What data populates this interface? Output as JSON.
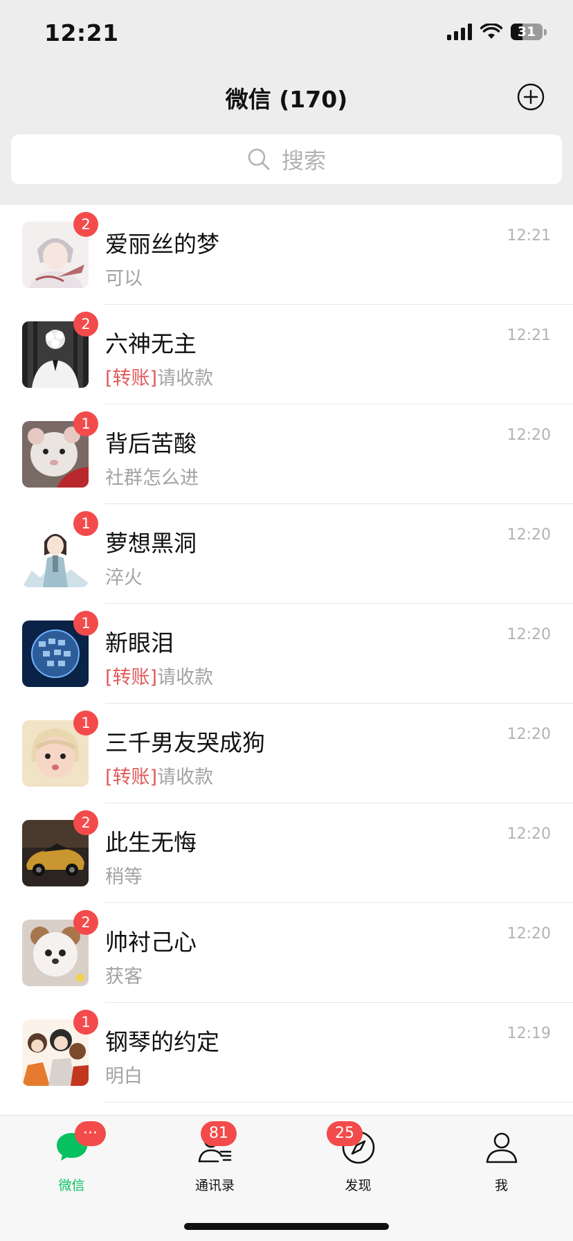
{
  "status": {
    "time": "12:21",
    "battery": "31"
  },
  "header": {
    "title": "微信 (170)"
  },
  "search": {
    "placeholder": "搜索"
  },
  "colors": {
    "accent": "#07c160",
    "badge": "#f34b4b",
    "transfer_tag": "#e05a5a"
  },
  "chats": [
    {
      "name": "爱丽丝的梦",
      "tag": "",
      "message": "可以",
      "time": "12:21",
      "badge": "2",
      "avatar": "anime-sketch"
    },
    {
      "name": "六神无主",
      "tag": "[转账]",
      "message": "请收款",
      "time": "12:21",
      "badge": "2",
      "avatar": "man-with-flowers"
    },
    {
      "name": "背后苦酸",
      "tag": "",
      "message": "社群怎么进",
      "time": "12:20",
      "badge": "1",
      "avatar": "hamster"
    },
    {
      "name": "萝想黑洞",
      "tag": "",
      "message": "淬火",
      "time": "12:20",
      "badge": "1",
      "avatar": "anime-girl"
    },
    {
      "name": "新眼泪",
      "tag": "[转账]",
      "message": "请收款",
      "time": "12:20",
      "badge": "1",
      "avatar": "globe"
    },
    {
      "name": "三千男友哭成狗",
      "tag": "[转账]",
      "message": "请收款",
      "time": "12:20",
      "badge": "1",
      "avatar": "baby"
    },
    {
      "name": "此生无悔",
      "tag": "",
      "message": "稍等",
      "time": "12:20",
      "badge": "2",
      "avatar": "sports-car"
    },
    {
      "name": "帅衬己心",
      "tag": "",
      "message": "获客",
      "time": "12:20",
      "badge": "2",
      "avatar": "puppy"
    },
    {
      "name": "钢琴的约定",
      "tag": "",
      "message": "明白",
      "time": "12:19",
      "badge": "1",
      "avatar": "cartoon-group"
    }
  ],
  "tabs": [
    {
      "label": "微信",
      "icon": "chat-bubble-icon",
      "badge": "···",
      "active": true
    },
    {
      "label": "通讯录",
      "icon": "contacts-icon",
      "badge": "81",
      "active": false
    },
    {
      "label": "发现",
      "icon": "compass-icon",
      "badge": "25",
      "active": false
    },
    {
      "label": "我",
      "icon": "profile-icon",
      "badge": "",
      "active": false
    }
  ]
}
